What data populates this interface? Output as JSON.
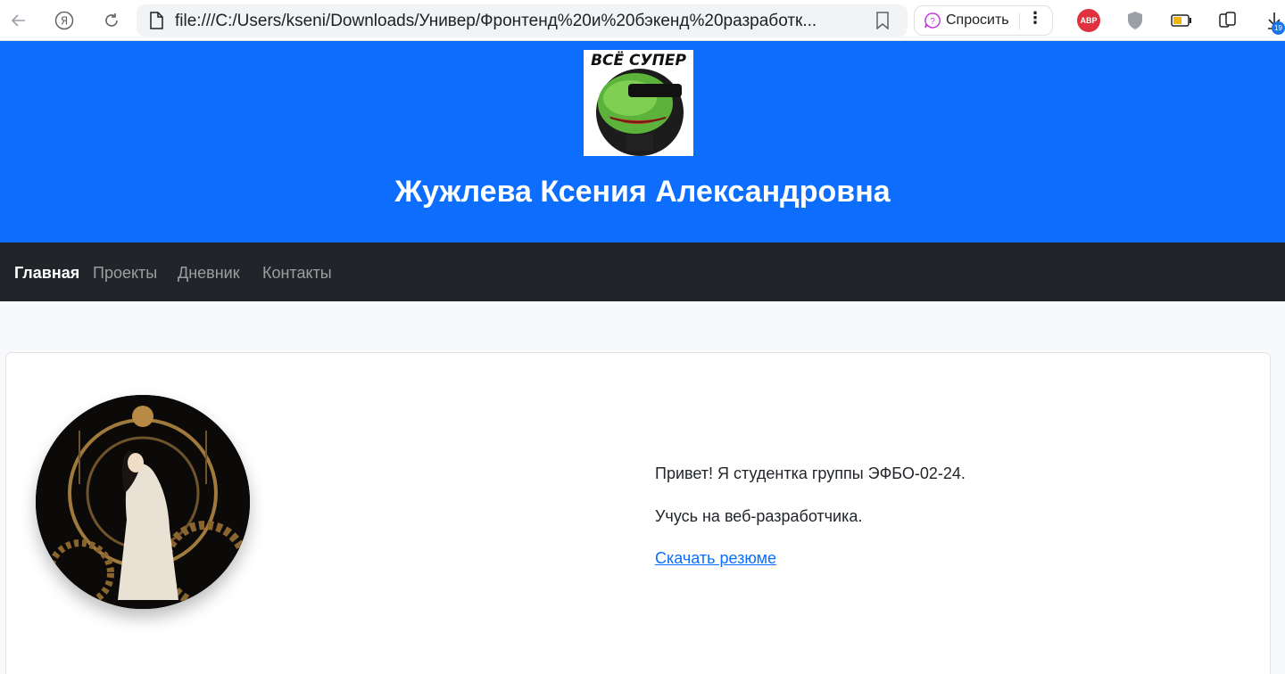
{
  "browser": {
    "url": "file:///C:/Users/kseni/Downloads/Универ/Фронтенд%20и%20бэкенд%20разработк...",
    "ask_label": "Спросить",
    "abp_label": "ABP",
    "downloads_count": "19"
  },
  "header": {
    "logo_text": "ВСЁ СУПЕР",
    "title": "Жужлева Ксения Александровна",
    "background": "#0d6efd"
  },
  "nav": {
    "items": [
      {
        "label": "Главная",
        "active": true
      },
      {
        "label": "Проекты",
        "active": false
      },
      {
        "label": "Дневник",
        "active": false
      },
      {
        "label": "Контакты",
        "active": false
      }
    ]
  },
  "main": {
    "greeting": "Привет! Я студентка группы ЭФБО-02-24.",
    "about": "Учусь на веб-разработчика.",
    "resume_link": "Скачать резюме"
  },
  "icons": [
    "back-arrow-icon",
    "yandex-icon",
    "reload-icon",
    "page-icon",
    "bookmark-icon",
    "alice-icon",
    "more-icon",
    "adblock-icon",
    "shield-icon",
    "battery-icon",
    "collections-icon",
    "download-icon"
  ]
}
